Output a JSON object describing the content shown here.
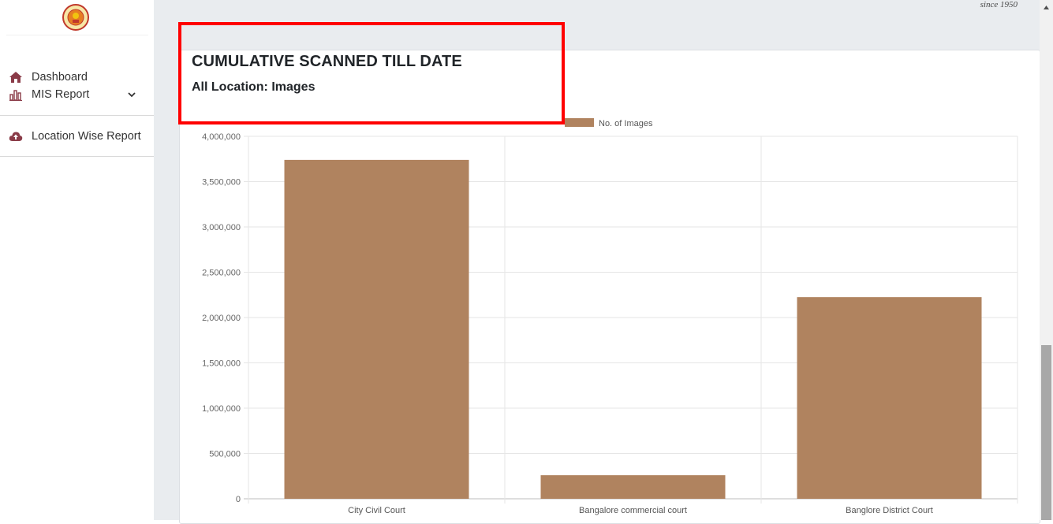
{
  "header": {
    "since_text": "since 1950"
  },
  "sidebar": {
    "items": [
      {
        "label": "Dashboard",
        "icon": "home-icon"
      },
      {
        "label": "MIS Report",
        "icon": "bar-chart-icon",
        "expandable": true
      },
      {
        "label": "Location Wise Report",
        "icon": "cloud-upload-icon"
      }
    ]
  },
  "main": {
    "title": "CUMULATIVE SCANNED TILL DATE",
    "subtitle": "All Location: Images"
  },
  "colors": {
    "bar": "#b0835f",
    "highlight": "#ff0000",
    "accent_icon": "#8a3b48"
  },
  "chart_data": {
    "type": "bar",
    "categories": [
      "City Civil Court",
      "Bangalore commercial court",
      "Banglore District Court"
    ],
    "series": [
      {
        "name": "No. of Images",
        "values": [
          3740000,
          260000,
          2225000
        ]
      }
    ],
    "ylim": [
      0,
      4000000
    ],
    "yticks": [
      0,
      500000,
      1000000,
      1500000,
      2000000,
      2500000,
      3000000,
      3500000,
      4000000
    ],
    "ytick_labels": [
      "0",
      "500,000",
      "1,000,000",
      "1,500,000",
      "2,000,000",
      "2,500,000",
      "3,000,000",
      "3,500,000",
      "4,000,000"
    ],
    "legend": "top-center",
    "grid": true
  }
}
